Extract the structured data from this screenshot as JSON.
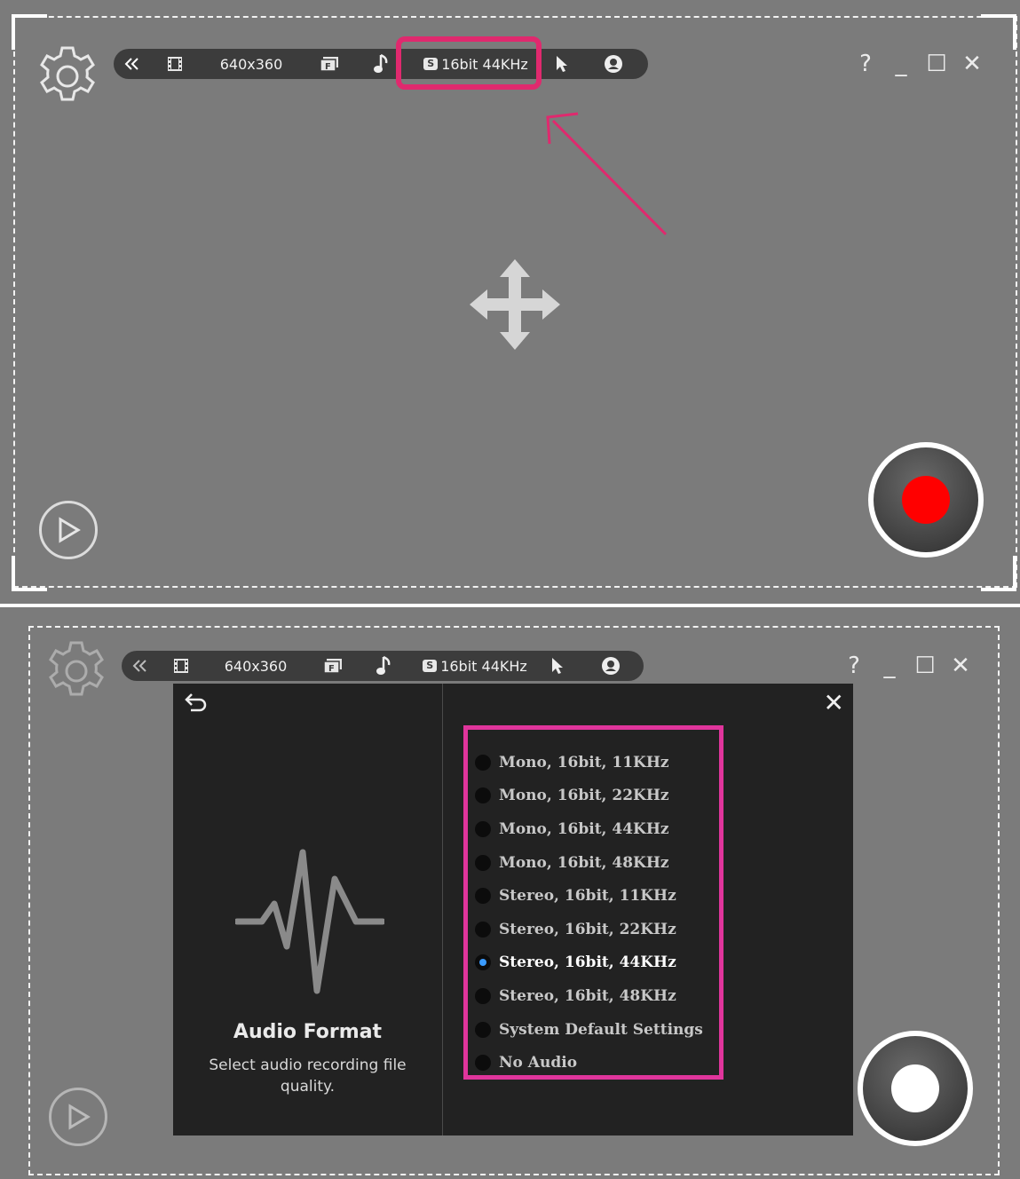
{
  "toolbar": {
    "collapse_icon": "double-chevron-left-icon",
    "resolution": "640x360",
    "audio_badge": "S",
    "audio_quality": "16bit 44KHz"
  },
  "window": {
    "help": "?",
    "minimize": "_",
    "maximize": "☐",
    "close": "✕"
  },
  "annotation_color": "#e0296e",
  "record": {
    "top_dot_color": "#ff0000",
    "bottom_dot_color": "#ffffff"
  },
  "dialog": {
    "title": "Audio Format",
    "description": "Select audio recording file quality.",
    "close_label": "✕",
    "options": [
      {
        "label": "Mono, 16bit, 11KHz",
        "selected": false
      },
      {
        "label": "Mono, 16bit, 22KHz",
        "selected": false
      },
      {
        "label": "Mono, 16bit, 44KHz",
        "selected": false
      },
      {
        "label": "Mono, 16bit, 48KHz",
        "selected": false
      },
      {
        "label": "Stereo, 16bit, 11KHz",
        "selected": false
      },
      {
        "label": "Stereo, 16bit, 22KHz",
        "selected": false
      },
      {
        "label": "Stereo, 16bit, 44KHz",
        "selected": true
      },
      {
        "label": "Stereo, 16bit, 48KHz",
        "selected": false
      },
      {
        "label": "System Default Settings",
        "selected": false
      },
      {
        "label": "No Audio",
        "selected": false
      }
    ]
  }
}
